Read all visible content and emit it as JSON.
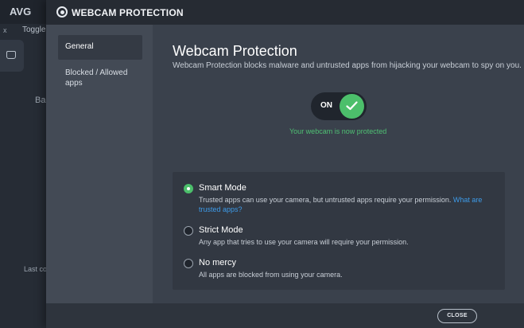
{
  "background_app": {
    "logo": "AVG",
    "close_x": "x",
    "toggle_label": "Toggle",
    "partial_text_1": "Ba",
    "partial_text_2": "Last co"
  },
  "dialog": {
    "title": "WEBCAM PROTECTION",
    "sidebar": {
      "items": [
        {
          "label": "General",
          "active": true
        },
        {
          "label": "Blocked / Allowed apps",
          "active": false
        }
      ]
    },
    "main": {
      "heading": "Webcam Protection",
      "description": "Webcam Protection blocks malware and untrusted apps from hijacking your webcam to spy on you.",
      "toggle": {
        "label": "ON",
        "state": "on"
      },
      "status": "Your webcam is now protected",
      "modes": [
        {
          "title": "Smart Mode",
          "description": "Trusted apps can use your camera, but untrusted apps require your permission. ",
          "link": "What are trusted apps?",
          "selected": true
        },
        {
          "title": "Strict Mode",
          "description": "Any app that tries to use your camera will require your permission.",
          "selected": false
        },
        {
          "title": "No mercy",
          "description": "All apps are blocked from using your camera.",
          "selected": false
        }
      ]
    },
    "footer": {
      "close_label": "CLOSE"
    }
  },
  "colors": {
    "accent_green": "#4cbf6b",
    "link_blue": "#3d9be9",
    "dialog_bg": "#3a414c",
    "titlebar_bg": "#262b33"
  },
  "icons": [
    "webcam-shield-icon",
    "checkmark-icon",
    "home-icon"
  ]
}
